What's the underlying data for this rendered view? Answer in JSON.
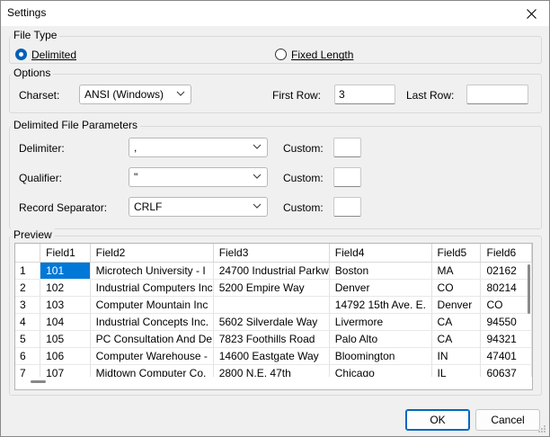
{
  "window": {
    "title": "Settings"
  },
  "file_type": {
    "label": "File Type",
    "options": [
      {
        "label": "Delimited",
        "selected": true
      },
      {
        "label": "Fixed Length",
        "selected": false
      }
    ]
  },
  "options": {
    "label": "Options",
    "charset_label": "Charset:",
    "charset_value": "ANSI (Windows)",
    "first_row_label": "First Row:",
    "first_row_value": "3",
    "last_row_label": "Last Row:",
    "last_row_value": ""
  },
  "delimited": {
    "label": "Delimited File Parameters",
    "rows": [
      {
        "label": "Delimiter:",
        "value": ",",
        "custom_label": "Custom:",
        "custom_value": ""
      },
      {
        "label": "Qualifier:",
        "value": "\"",
        "custom_label": "Custom:",
        "custom_value": ""
      },
      {
        "label": "Record Separator:",
        "value": "CRLF",
        "custom_label": "Custom:",
        "custom_value": ""
      }
    ]
  },
  "preview": {
    "label": "Preview",
    "columns": [
      "",
      "Field1",
      "Field2",
      "Field3",
      "Field4",
      "Field5",
      "Field6"
    ],
    "rows": [
      [
        "1",
        "101",
        "Microtech University - I",
        "24700 Industrial Parkw",
        "Boston",
        "MA",
        "02162"
      ],
      [
        "2",
        "102",
        "Industrial Computers Inc",
        "5200 Empire Way",
        "Denver",
        "CO",
        "80214"
      ],
      [
        "3",
        "103",
        "Computer Mountain Inc",
        "",
        "14792 15th Ave. E.",
        "Denver",
        "CO"
      ],
      [
        "4",
        "104",
        "Industrial Concepts Inc.",
        "5602 Silverdale Way",
        "Livermore",
        "CA",
        "94550"
      ],
      [
        "5",
        "105",
        "PC Consultation And De",
        "7823 Foothills Road",
        "Palo Alto",
        "CA",
        "94321"
      ],
      [
        "6",
        "106",
        "Computer Warehouse -",
        "14600 Eastgate Way",
        "Bloomington",
        "IN",
        "47401"
      ],
      [
        "7",
        "107",
        "Midtown Computer Co.",
        "2800 N.E. 47th",
        "Chicago",
        "IL",
        "60637"
      ]
    ]
  },
  "buttons": {
    "ok": "OK",
    "cancel": "Cancel"
  },
  "colors": {
    "accent": "#005fb8",
    "selection": "#0078d7"
  }
}
